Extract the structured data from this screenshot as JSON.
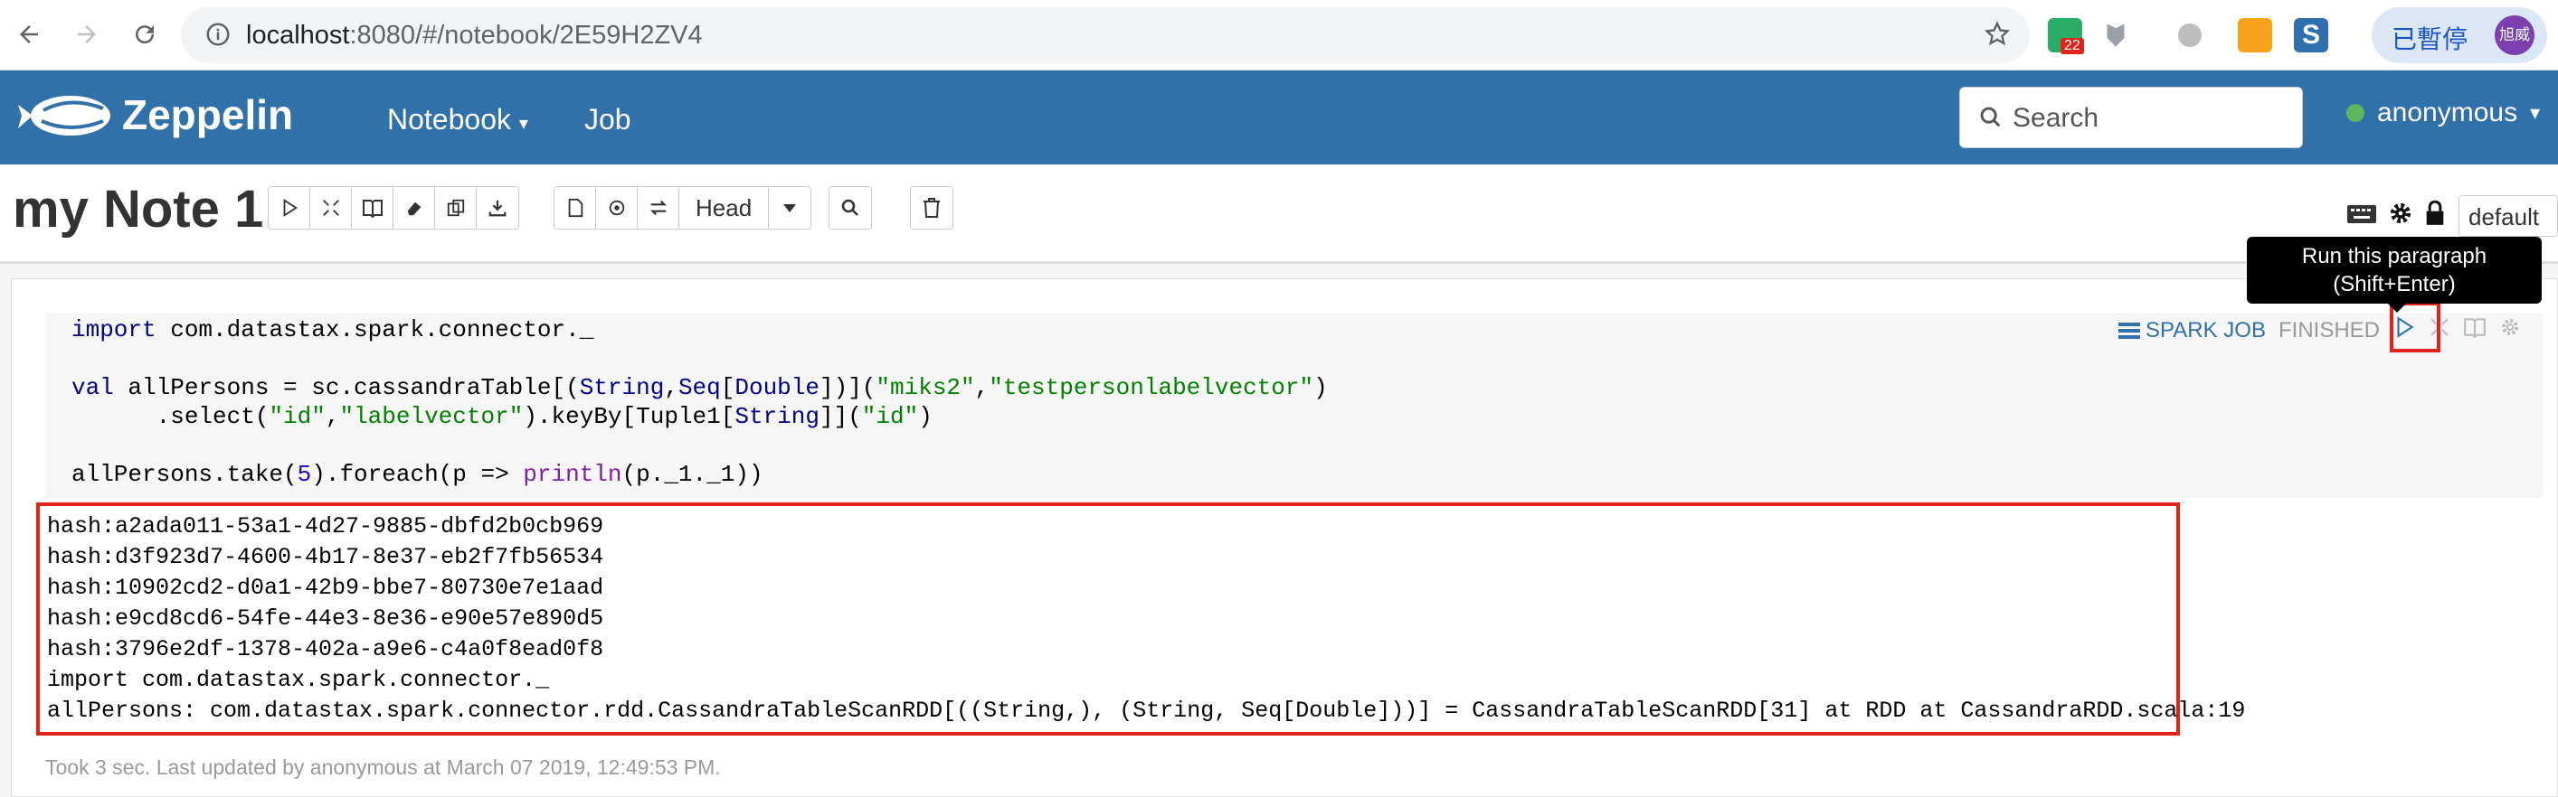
{
  "browser": {
    "url_host": "localhost",
    "url_rest": ":8080/#/notebook/2E59H2ZV4",
    "badge": "22",
    "profile_label": "已暫停",
    "avatar_text": "旭威"
  },
  "navbar": {
    "brand": "Zeppelin",
    "menu_notebook": "Notebook",
    "menu_job": "Job",
    "search_placeholder": "Search",
    "user": "anonymous"
  },
  "note": {
    "title": "my Note 1",
    "head_label": "Head",
    "interpreter": "default"
  },
  "paragraph": {
    "spark_job": "SPARK JOB",
    "status": "FINISHED",
    "tooltip_line1": "Run this paragraph",
    "tooltip_line2": "(Shift+Enter)",
    "code": [
      "import com.datastax.spark.connector._",
      "",
      "val allPersons = sc.cassandraTable[(String,Seq[Double])](\"miks2\",\"testpersonlabelvector\")",
      "      .select(\"id\",\"labelvector\").keyBy[Tuple1[String]](\"id\")",
      "",
      "allPersons.take(5).foreach(p => println(p._1._1))"
    ],
    "output": [
      "hash:a2ada011-53a1-4d27-9885-dbfd2b0cb969",
      "hash:d3f923d7-4600-4b17-8e37-eb2f7fb56534",
      "hash:10902cd2-d0a1-42b9-bbe7-80730e7e1aad",
      "hash:e9cd8cd6-54fe-44e3-8e36-e90e57e890d5",
      "hash:3796e2df-1378-402a-a9e6-c4a0f8ead0f8",
      "import com.datastax.spark.connector._",
      "allPersons: com.datastax.spark.connector.rdd.CassandraTableScanRDD[((String,), (String, Seq[Double]))] = CassandraTableScanRDD[31] at RDD at CassandraRDD.scala:19"
    ],
    "footer": "Took 3 sec. Last updated by anonymous at March 07 2019, 12:49:53 PM."
  },
  "colors": {
    "navbar": "#3071a9",
    "highlight": "#e2231a",
    "online": "#5cb85c"
  }
}
